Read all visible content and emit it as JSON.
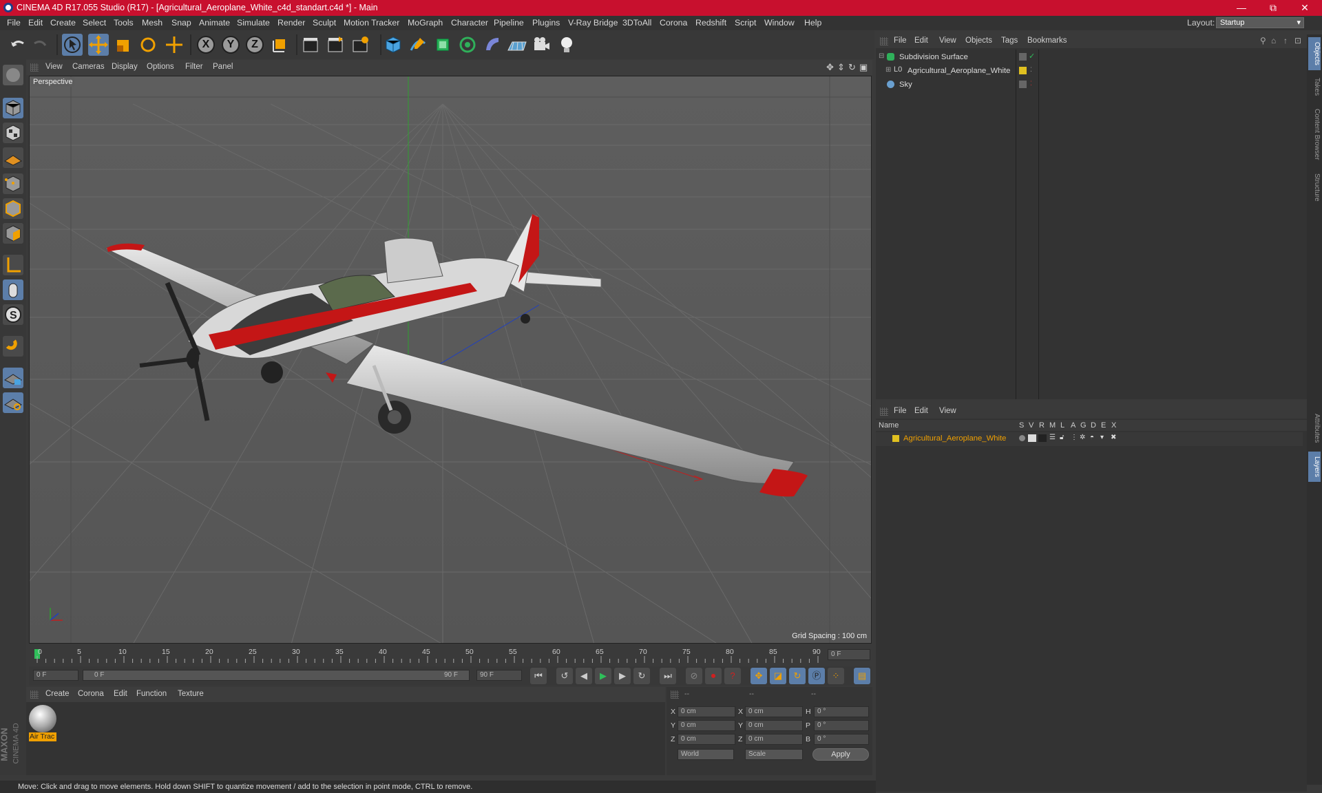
{
  "titlebar": {
    "title": "CINEMA 4D R17.055 Studio (R17) - [Agricultural_Aeroplane_White_c4d_standart.c4d *] - Main",
    "min": "—",
    "max": "⧉",
    "close": "✕"
  },
  "menu": [
    "File",
    "Edit",
    "Create",
    "Select",
    "Tools",
    "Mesh",
    "Snap",
    "Animate",
    "Simulate",
    "Render",
    "Sculpt",
    "Motion Tracker",
    "MoGraph",
    "Character",
    "Pipeline",
    "Plugins",
    "V-Ray Bridge",
    "3DToAll",
    "Corona",
    "Redshift",
    "Script",
    "Window",
    "Help"
  ],
  "layout": {
    "label": "Layout:",
    "value": "Startup"
  },
  "toolbar": {
    "axis_x": "X",
    "axis_y": "Y",
    "axis_z": "Z"
  },
  "viewport": {
    "menu": [
      "View",
      "Cameras",
      "Display",
      "Options",
      "Filter",
      "Panel"
    ],
    "camera": "Perspective",
    "grid_spacing": "Grid Spacing : 100 cm"
  },
  "timeline": {
    "ticks": [
      "0",
      "5",
      "10",
      "15",
      "20",
      "25",
      "30",
      "35",
      "40",
      "45",
      "50",
      "55",
      "60",
      "65",
      "70",
      "75",
      "80",
      "85",
      "90"
    ],
    "current": "0 F"
  },
  "transport": {
    "start": "0 F",
    "range_start": "0 F",
    "range_end": "90 F",
    "end": "90 F"
  },
  "material_panel": {
    "menu": [
      "Create",
      "Corona",
      "Edit",
      "Function",
      "Texture"
    ],
    "material_name": "Air Trac"
  },
  "coords": {
    "headers": [
      "--",
      "--",
      "--"
    ],
    "rows": [
      {
        "a": "X",
        "av": "0 cm",
        "b": "X",
        "bv": "0 cm",
        "c": "H",
        "cv": "0 °"
      },
      {
        "a": "Y",
        "av": "0 cm",
        "b": "Y",
        "bv": "0 cm",
        "c": "P",
        "cv": "0 °"
      },
      {
        "a": "Z",
        "av": "0 cm",
        "b": "Z",
        "bv": "0 cm",
        "c": "B",
        "cv": "0 °"
      }
    ],
    "mode1": "World",
    "mode2": "Scale",
    "apply": "Apply"
  },
  "objects": {
    "menu": [
      "File",
      "Edit",
      "View",
      "Objects",
      "Tags",
      "Bookmarks"
    ],
    "items": [
      {
        "name": "Subdivision Surface"
      },
      {
        "name": "Agricultural_Aeroplane_White"
      },
      {
        "name": "Sky"
      }
    ]
  },
  "layers": {
    "menu": [
      "File",
      "Edit",
      "View"
    ],
    "columns": [
      "Name",
      "S",
      "V",
      "R",
      "M",
      "L",
      "A",
      "G",
      "D",
      "E",
      "X"
    ],
    "items": [
      {
        "name": "Agricultural_Aeroplane_White",
        "color": "#e0c020"
      }
    ]
  },
  "right_tabs": [
    "Objects",
    "Takes",
    "Content Browser",
    "Structure",
    "Attributes",
    "Layers"
  ],
  "brand": [
    "MAXON",
    "CINEMA 4D"
  ],
  "status": "Move: Click and drag to move elements. Hold down SHIFT to quantize movement / add to the selection in point mode, CTRL to remove."
}
